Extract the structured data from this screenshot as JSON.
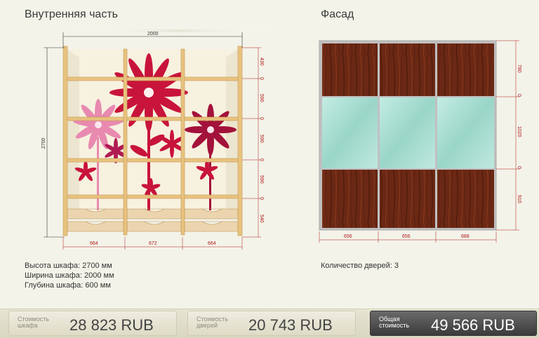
{
  "sections": {
    "inner_title": "Внутренняя часть",
    "facade_title": "Фасад"
  },
  "inner_drawing": {
    "width_label": "2000",
    "height_label": "2700",
    "shelf_gaps": [
      "430",
      "590",
      "590",
      "590",
      "540"
    ],
    "zero_marks": [
      "0",
      "0",
      "0",
      "0"
    ],
    "section_widths": [
      "664",
      "672",
      "664"
    ],
    "colors": {
      "board": "#e8c27f",
      "back": "#f7f1e0",
      "flower_red": "#c8143a",
      "flower_pink": "#e88ab0",
      "dim_red": "#b01818"
    }
  },
  "facade_drawing": {
    "panel_heights": [
      "780",
      "1020",
      "910"
    ],
    "zero_marks": [
      "0",
      "0"
    ],
    "door_widths": [
      "656",
      "656",
      "688"
    ],
    "colors": {
      "frame": "#c0c0c0",
      "wood": "#6b2814",
      "mirror": "#a7ded2"
    }
  },
  "inner_info": {
    "height": "Высота шкафа: 2700 мм",
    "width": "Ширина шкафа: 2000 мм",
    "depth": "Глубина шкафа: 600 мм"
  },
  "facade_info": {
    "doors": "Количество дверей: 3"
  },
  "prices": {
    "cabinet": {
      "label_1": "Стоимость",
      "label_2": "шкафа",
      "value": "28 823  RUB"
    },
    "doors": {
      "label_1": "Стоимость",
      "label_2": "дверей",
      "value": "20 743  RUB"
    },
    "total": {
      "label_1": "Общая",
      "label_2": "стоимость",
      "value": "49 566  RUB"
    }
  }
}
